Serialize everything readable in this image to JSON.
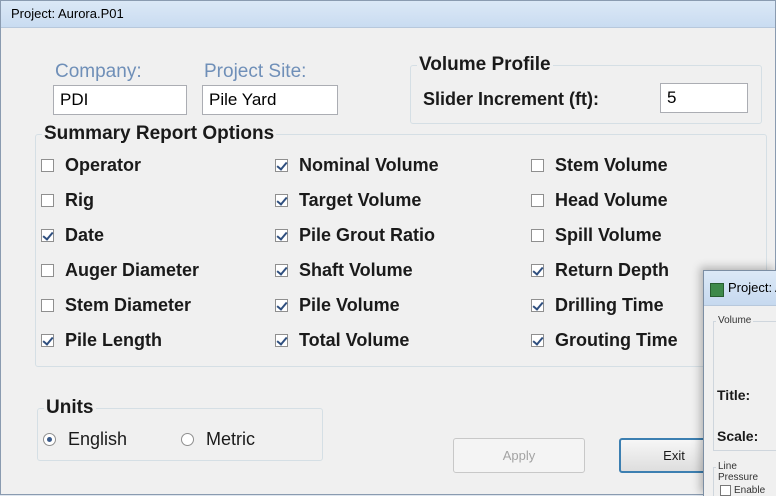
{
  "window": {
    "title": "Project: Aurora.P01"
  },
  "company": {
    "label": "Company:",
    "value": "PDI"
  },
  "project_site": {
    "label": "Project Site:",
    "value": "Pile Yard"
  },
  "volume_profile": {
    "title": "Volume Profile",
    "slider_label": "Slider Increment (ft):",
    "slider_value": "5"
  },
  "summary": {
    "title": "Summary Report Options",
    "options": [
      {
        "label": "Operator",
        "checked": false
      },
      {
        "label": "Rig",
        "checked": false
      },
      {
        "label": "Date",
        "checked": true
      },
      {
        "label": "Auger Diameter",
        "checked": false
      },
      {
        "label": "Stem Diameter",
        "checked": false
      },
      {
        "label": "Pile Length",
        "checked": true
      },
      {
        "label": "Nominal Volume",
        "checked": true
      },
      {
        "label": "Target Volume",
        "checked": true
      },
      {
        "label": "Pile Grout Ratio",
        "checked": true
      },
      {
        "label": "Shaft Volume",
        "checked": true
      },
      {
        "label": "Pile Volume",
        "checked": true
      },
      {
        "label": "Total Volume",
        "checked": true
      },
      {
        "label": "Stem Volume",
        "checked": false
      },
      {
        "label": "Head Volume",
        "checked": false
      },
      {
        "label": "Spill Volume",
        "checked": false
      },
      {
        "label": "Return Depth",
        "checked": true
      },
      {
        "label": "Drilling Time",
        "checked": true
      },
      {
        "label": "Grouting Time",
        "checked": true
      }
    ]
  },
  "units": {
    "title": "Units",
    "english": "English",
    "metric": "Metric",
    "selected": "English"
  },
  "buttons": {
    "apply": "Apply",
    "exit": "Exit"
  },
  "second_window": {
    "title": "Project: A",
    "group_label": "Volume",
    "title_label": "Title:",
    "scale_label": "Scale:",
    "line_group_label": "Line Pressure",
    "checkbox_label": "Enable"
  }
}
